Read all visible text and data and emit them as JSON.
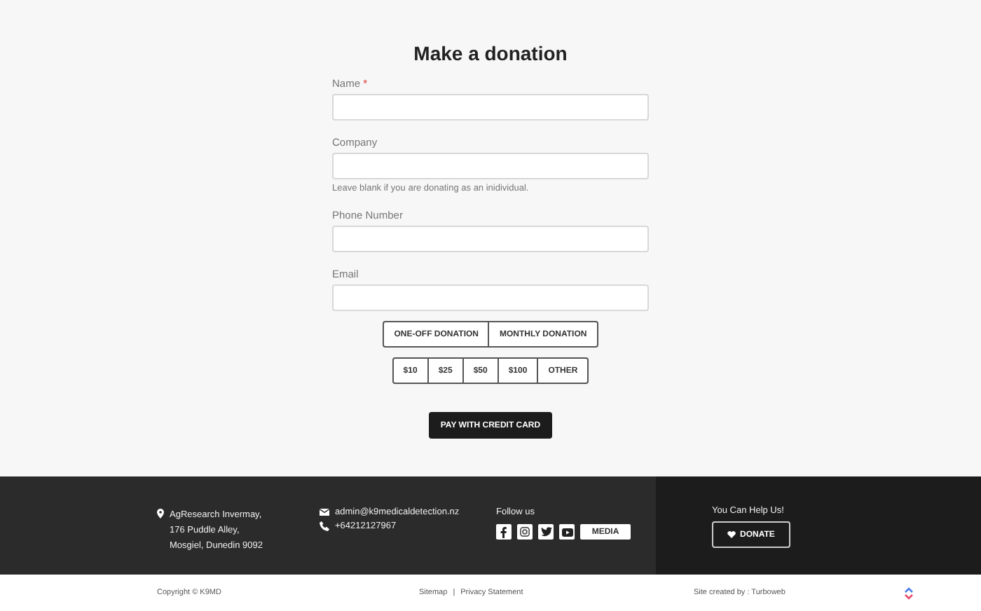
{
  "title": "Make a donation",
  "fields": [
    {
      "label": "Name",
      "required_mark": "*"
    },
    {
      "label": "Company",
      "hint": "Leave blank if you are donating as an inidividual."
    },
    {
      "label": "Phone Number"
    },
    {
      "label": "Email"
    }
  ],
  "donation_types": [
    "ONE-OFF DONATION",
    "MONTHLY DONATION"
  ],
  "amounts": [
    "$10",
    "$25",
    "$50",
    "$100",
    "OTHER"
  ],
  "pay_button": "PAY WITH CREDIT CARD",
  "footer": {
    "address": [
      "AgResearch Invermay,",
      "176 Puddle Alley,",
      "Mosgiel, Dunedin 9092"
    ],
    "email": "admin@k9medicaldetection.nz",
    "phone": "+64212127967",
    "follow_title": "Follow us",
    "social": [
      {
        "kind": "facebook"
      },
      {
        "kind": "instagram"
      },
      {
        "kind": "twitter"
      },
      {
        "kind": "youtube"
      }
    ],
    "media_button": "MEDIA",
    "help_title": "You Can Help Us!",
    "donate_button": "DONATE"
  },
  "bottom_bar": {
    "copyright": "Copyright © K9MD",
    "links": [
      "Sitemap",
      "Privacy Statement"
    ],
    "separator": "|",
    "credit": "Site created by : Turboweb"
  }
}
